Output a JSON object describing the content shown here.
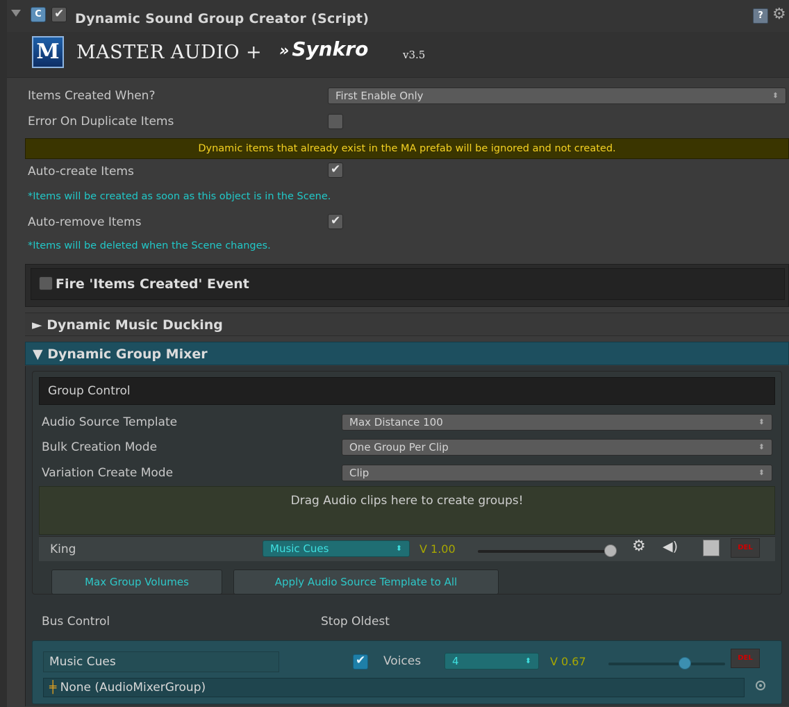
{
  "header": {
    "title": "Dynamic Sound Group Creator (Script)",
    "enabled": true,
    "icons": [
      "script-icon",
      "help-icon",
      "gear-icon"
    ]
  },
  "logo": {
    "master_audio": "MASTER AUDIO +",
    "synkro": "Synkro",
    "version": "v3.5",
    "m_glyph": "M"
  },
  "settings": {
    "items_created_when": {
      "label": "Items Created When?",
      "value": "First Enable Only"
    },
    "error_on_duplicate": {
      "label": "Error On Duplicate Items",
      "checked": false
    },
    "duplicate_warning": "Dynamic items that already exist in the MA prefab will be ignored and not created.",
    "auto_create": {
      "label": "Auto-create Items",
      "checked": true,
      "hint": "*Items will be created as soon as this object is in the Scene."
    },
    "auto_remove": {
      "label": "Auto-remove Items",
      "checked": true,
      "hint": "*Items will be deleted when the Scene changes."
    }
  },
  "event": {
    "label": "Fire 'Items Created' Event",
    "checked": false
  },
  "sections": {
    "music_ducking": "► Dynamic Music Ducking",
    "group_mixer": "▼ Dynamic Group Mixer"
  },
  "group_control": {
    "title": "Group Control",
    "audio_source_template": {
      "label": "Audio Source Template",
      "value": "Max Distance 100"
    },
    "bulk_creation_mode": {
      "label": "Bulk Creation Mode",
      "value": "One Group Per Clip"
    },
    "variation_create_mode": {
      "label": "Variation Create Mode",
      "value": "Clip"
    },
    "drop_zone": "Drag Audio clips here to create groups!",
    "groups": [
      {
        "name": "King",
        "bus": "Music Cues",
        "volume_label": "V 1.00",
        "volume": 1.0,
        "del": "DEL"
      }
    ],
    "max_group_volumes": "Max Group Volumes",
    "apply_template_all": "Apply Audio Source Template to All"
  },
  "bus_control": {
    "title": "Bus Control",
    "stop_oldest": "Stop Oldest",
    "buses": [
      {
        "name": "Music Cues",
        "stop_oldest": true,
        "voices_label": "Voices",
        "voices": "4",
        "volume_label": "V 0.67",
        "volume": 0.67,
        "del": "DEL",
        "mixer_group": "None (AudioMixerGroup)"
      }
    ]
  },
  "colors": {
    "accent_teal": "#2ec8c8",
    "warning_yellow": "#f5d222",
    "delete_red": "#d00000",
    "mixer_header": "#1d4f5f"
  }
}
